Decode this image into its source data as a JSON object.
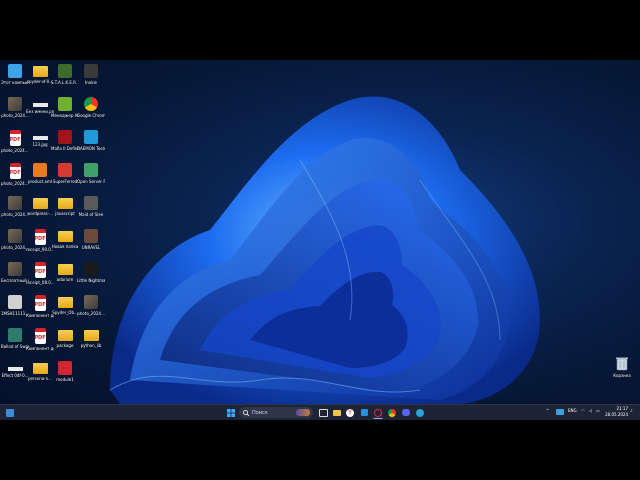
{
  "desktop": {
    "icons": [
      {
        "label": "Этот компьютер",
        "type": "pc",
        "color": "#3ea3e6"
      },
      {
        "label": "spyder-vf-0...",
        "type": "folder"
      },
      {
        "label": "S.T.A.L.K.E.R. ЗОВ ПРИ...",
        "type": "app",
        "color": "#3d6b2a"
      },
      {
        "label": "Inokie",
        "type": "app",
        "color": "#3a3a3a"
      },
      {
        "label": "photo_2024...",
        "type": "img"
      },
      {
        "label": "Без имени.png",
        "type": "white"
      },
      {
        "label": "Менеджер Adaptive...",
        "type": "app",
        "color": "#6fb12b"
      },
      {
        "label": "Google Chrome",
        "type": "chrome",
        "color": "#ffffff"
      },
      {
        "label": "photo_2024... 2.pdf",
        "type": "pdf"
      },
      {
        "label": "123.jpg",
        "type": "white"
      },
      {
        "label": "Mafia II Definiti...",
        "type": "app",
        "color": "#a2131a"
      },
      {
        "label": "DAEMON Tools Lite",
        "type": "app",
        "color": "#1e9ad6"
      },
      {
        "label": "photo_2024... 1.pdf",
        "type": "pdf"
      },
      {
        "label": "product.xml",
        "type": "app",
        "color": "#e87a1f"
      },
      {
        "label": "SuperFerrod",
        "type": "app",
        "color": "#d23b2e"
      },
      {
        "label": "Open Server Panel",
        "type": "app",
        "color": "#3fa06a"
      },
      {
        "label": "photo_2024...",
        "type": "img"
      },
      {
        "label": "wordpress-...",
        "type": "folder"
      },
      {
        "label": "javascript",
        "type": "folder"
      },
      {
        "label": "Maid of Slee",
        "type": "app",
        "color": "#5a5a5a"
      },
      {
        "label": "photo_2024...",
        "type": "img"
      },
      {
        "label": "receipt_90.0...",
        "type": "pdf"
      },
      {
        "label": "Новая папка",
        "type": "folder"
      },
      {
        "label": "UNRAVEL",
        "type": "app",
        "color": "#6a4a3a"
      },
      {
        "label": "Бесплатный sypsc.png",
        "type": "img"
      },
      {
        "label": "receipt_08.0... (2).pdf",
        "type": "pdf"
      },
      {
        "label": "adarium",
        "type": "folder"
      },
      {
        "label": "Little Nightmare...",
        "type": "app",
        "color": "#1a1a1a"
      },
      {
        "label": "1MSH11111...",
        "type": "app",
        "color": "#d0d0d0"
      },
      {
        "label": "Компонент документа...",
        "type": "pdf"
      },
      {
        "label": "Spyder_Ob...",
        "type": "folder"
      },
      {
        "label": "photo_2024...",
        "type": "img"
      },
      {
        "label": "Ballad of Swan Lake",
        "type": "app",
        "color": "#2f7a6a"
      },
      {
        "label": "Компонент документа-b...",
        "type": "pdf"
      },
      {
        "label": "package",
        "type": "folder"
      },
      {
        "label": "python_lib",
        "type": "folder"
      },
      {
        "label": "Effect 04f-0...",
        "type": "white"
      },
      {
        "label": "persona-n...",
        "type": "folder"
      },
      {
        "label": "module1",
        "type": "app",
        "color": "#d4242d"
      }
    ],
    "recycle_bin": {
      "label": "Корзина",
      "icon": "recycle-bin-icon"
    }
  },
  "taskbar": {
    "search_placeholder": "Поиск",
    "tray": {
      "language": "ENG",
      "time": "21:17",
      "date": "28.05.2024"
    }
  }
}
